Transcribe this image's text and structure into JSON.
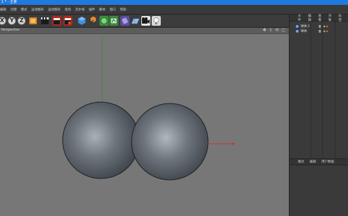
{
  "window": {
    "title": "1 * - 主要"
  },
  "menu": [
    "编辑",
    "创建",
    "模式",
    "运动图形",
    "运动图形",
    "角色",
    "流水线",
    "插件",
    "脚本",
    "窗口",
    "帮助"
  ],
  "toolbar": {
    "axis_x": "X",
    "axis_y": "Y",
    "axis_z": "Z"
  },
  "viewport": {
    "label": "Perspective",
    "nav_icons": "✥ ⇩ ⟲ ▢"
  },
  "object_manager": {
    "tabs": [
      "文件",
      "编辑",
      "查看",
      "对象",
      "标签"
    ],
    "objects": [
      {
        "name": "球体.1"
      },
      {
        "name": "球体"
      }
    ]
  },
  "attribute_manager": {
    "tabs": [
      "模式",
      "编辑",
      "用户数据"
    ]
  },
  "colors": {
    "title_bar": "#1f7ae0",
    "viewport_bg": "#777777",
    "sphere": "#5f6770",
    "y_axis": "#3f8a3f",
    "x_axis": "#c0392b"
  }
}
